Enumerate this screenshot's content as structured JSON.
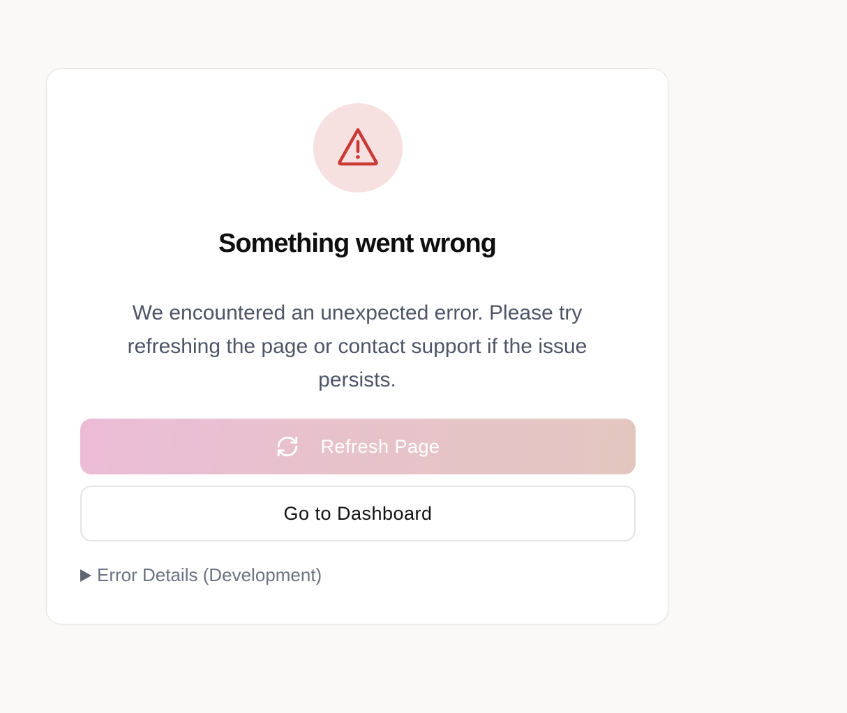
{
  "error": {
    "title": "Something went wrong",
    "message": "We encountered an unexpected error. Please try refreshing the page or contact support if the issue persists.",
    "icon": "warning-triangle-icon",
    "icon_color": "#c93a35",
    "icon_bg": "#f7e1e0"
  },
  "actions": {
    "refresh_label": "Refresh Page",
    "refresh_icon": "refresh-icon",
    "dashboard_label": "Go to Dashboard"
  },
  "details": {
    "label": "Error Details (Development)",
    "expanded": false
  }
}
